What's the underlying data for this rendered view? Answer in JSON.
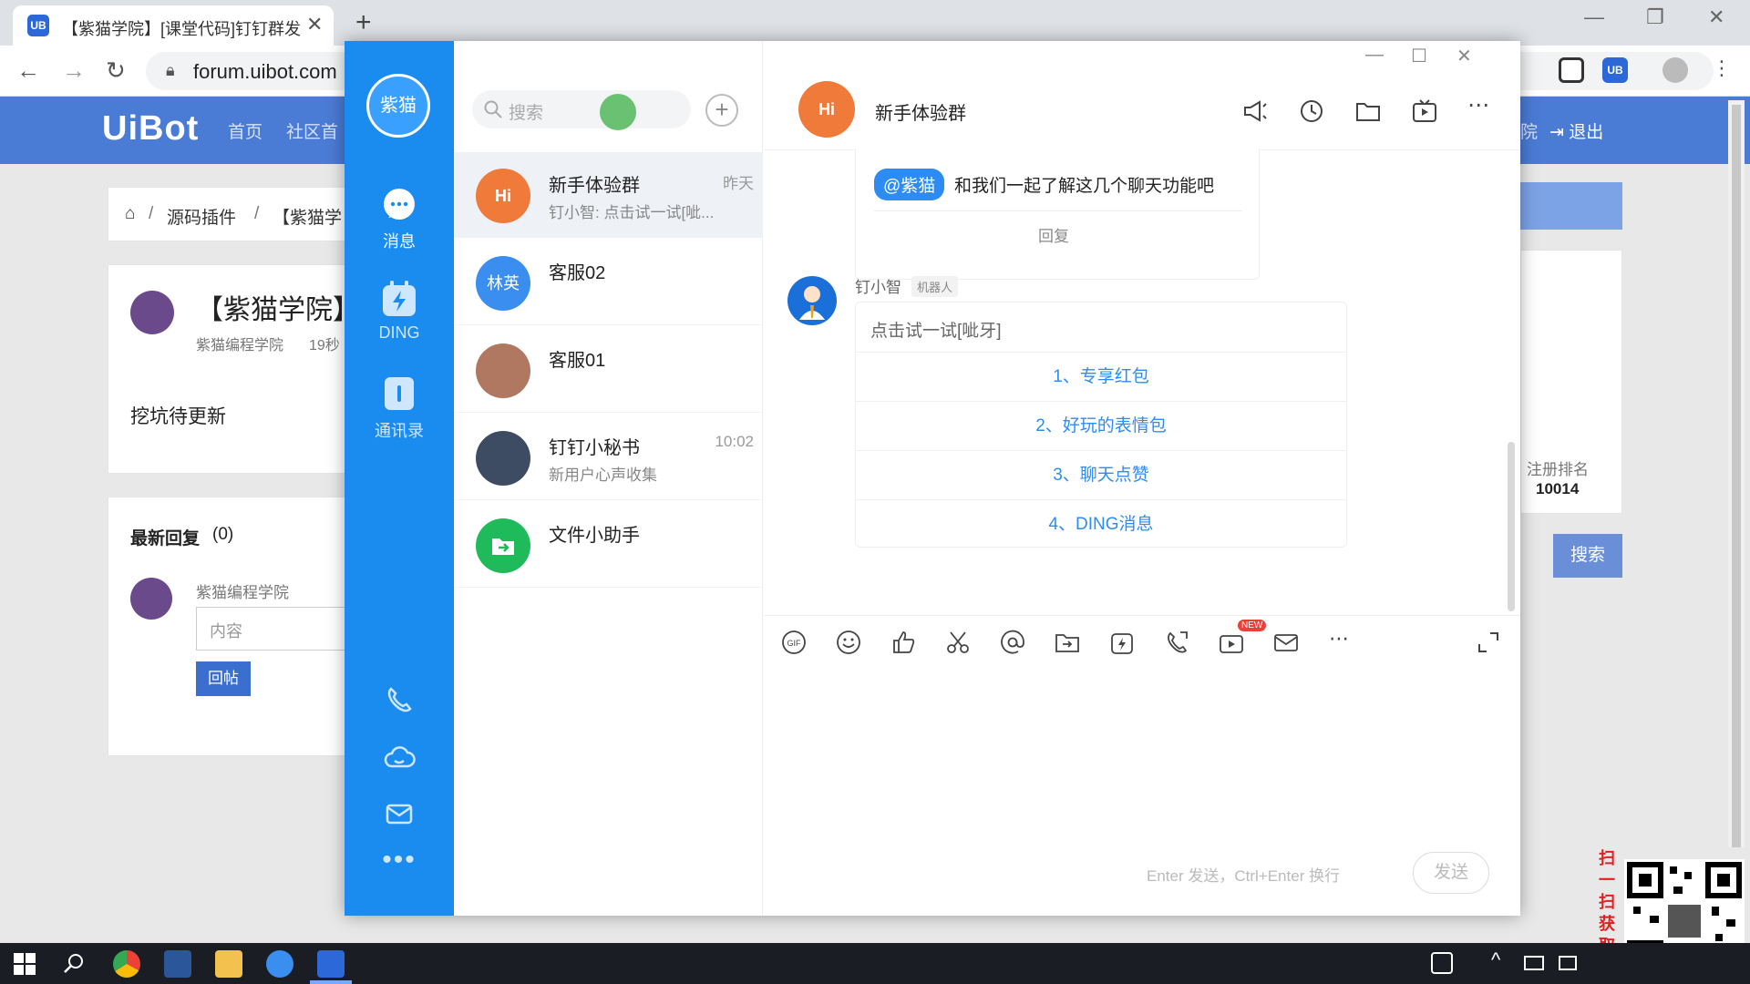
{
  "browser": {
    "tab_title": "【紫猫学院】[课堂代码]钉钉群发",
    "tab_favicon": "UB",
    "url": "forum.uibot.com"
  },
  "site": {
    "logo": "UiBot",
    "nav": [
      "首页",
      "社区首"
    ],
    "nav_right": [
      "院",
      "退出"
    ],
    "breadcrumb": [
      "源码插件",
      "【紫猫学"
    ],
    "post_title": "【紫猫学院】",
    "author": "紫猫编程学院",
    "time": "19秒",
    "content": "挖坑待更新",
    "replies_label": "最新回复",
    "replies_count": "(0)",
    "reply_author": "紫猫编程学院",
    "reply_placeholder": "内容",
    "reply_button": "回帖",
    "rank_label": "注册排名",
    "rank_value": "10014",
    "search_button": "搜索"
  },
  "dingtalk": {
    "me_avatar": "紫猫",
    "sidebar": [
      {
        "label": "消息",
        "icon": "chat-bubble-icon"
      },
      {
        "label": "DING",
        "icon": "ding-lightning-icon"
      },
      {
        "label": "通讯录",
        "icon": "contacts-icon"
      }
    ],
    "search_placeholder": "搜索",
    "conversations": [
      {
        "name": "新手体验群",
        "preview": "钉小智: 点击试一试[呲...",
        "time": "昨天",
        "avatar_text": "Hi",
        "avatar_color": "#f07a3a"
      },
      {
        "name": "客服02",
        "preview": "",
        "time": "",
        "avatar_text": "林英",
        "avatar_color": "#3a8ef0"
      },
      {
        "name": "客服01",
        "preview": "",
        "time": "",
        "avatar_text": "",
        "avatar_color": "#b07860"
      },
      {
        "name": "钉钉小秘书",
        "preview": "新用户心声收集",
        "time": "10:02",
        "avatar_text": "",
        "avatar_color": "#3d4c63"
      },
      {
        "name": "文件小助手",
        "preview": "",
        "time": "",
        "avatar_text": "",
        "avatar_color": "#1fba5a"
      }
    ],
    "chat": {
      "title": "新手体验群",
      "prev_mention": "@紫猫",
      "prev_text": "和我们一起了解这几个聊天功能吧",
      "reply_label": "回复",
      "sender": "钉小智",
      "sender_tag": "机器人",
      "bot_intro": "点击试一试[呲牙]",
      "options": [
        "1、专享红包",
        "2、好玩的表情包",
        "3、聊天点赞",
        "4、DING消息"
      ],
      "input_hint": "Enter 发送，Ctrl+Enter 换行",
      "send_label": "发送",
      "new_badge": "NEW"
    }
  },
  "qr_caption": "扫一扫获取教程",
  "colors": {
    "dingtalk_blue": "#1a8cf0",
    "forum_blue": "#4a7bd5",
    "link_blue": "#2c8cf4"
  }
}
